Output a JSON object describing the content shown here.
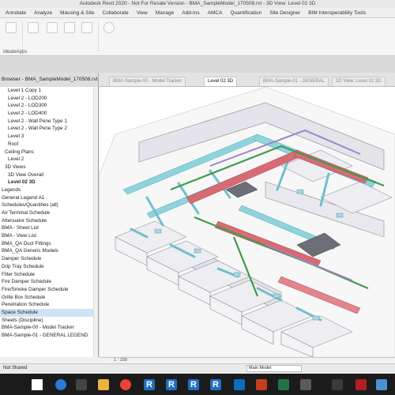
{
  "window": {
    "title": "Autodesk Revit 2020 - Not For Resale Version - BMA_SampleModel_170508.rvt - 3D View: Level 02 3D"
  },
  "menu": [
    "Annotate",
    "Analyze",
    "Massing & Site",
    "Collaborate",
    "View",
    "Manage",
    "Add-Ins",
    "AMCA",
    "Quantification",
    "Site Designer",
    "BIM Interoperability Tools"
  ],
  "ribbon": {
    "panel_label": "IdeateApps"
  },
  "browser": {
    "header": "Browser - BMA_SampleModel_170508.rvt",
    "items": [
      {
        "label": "Level 1 Copy 1",
        "indent": 2
      },
      {
        "label": "Level 2 - LOD200",
        "indent": 2
      },
      {
        "label": "Level 2 - LOD300",
        "indent": 2
      },
      {
        "label": "Level 2 - LOD400",
        "indent": 2
      },
      {
        "label": "Level 2 - Wall Pene Type 1",
        "indent": 2
      },
      {
        "label": "Level 2 - Wall Pene Type 2",
        "indent": 2
      },
      {
        "label": "Level 3",
        "indent": 2
      },
      {
        "label": "Roof",
        "indent": 2
      },
      {
        "label": "Ceiling Plans",
        "indent": 1
      },
      {
        "label": "Level 2",
        "indent": 2
      },
      {
        "label": "3D Views",
        "indent": 1
      },
      {
        "label": "3D View Overall",
        "indent": 2
      },
      {
        "label": "Level 02 3D",
        "indent": 2,
        "bold": true
      },
      {
        "label": "Legends",
        "indent": 0
      },
      {
        "label": "General Legend A1",
        "indent": 0
      },
      {
        "label": "Schedules/Quantities (all)",
        "indent": 0
      },
      {
        "label": "Air Terminal Schedule",
        "indent": 0
      },
      {
        "label": "Attenuator Schedule",
        "indent": 0
      },
      {
        "label": "BMA - Sheet List",
        "indent": 0
      },
      {
        "label": "BMA - View List",
        "indent": 0
      },
      {
        "label": "BMA_QA Duct Fittings",
        "indent": 0
      },
      {
        "label": "BMA_QA Generic Models",
        "indent": 0
      },
      {
        "label": "Damper Schedule",
        "indent": 0
      },
      {
        "label": "Drip Tray Schedule",
        "indent": 0
      },
      {
        "label": "Filter Schedule",
        "indent": 0
      },
      {
        "label": "Fire Damper Schedule",
        "indent": 0
      },
      {
        "label": "Fire/Smoke Damper Schedule",
        "indent": 0
      },
      {
        "label": "Grille Box Schedule",
        "indent": 0
      },
      {
        "label": "Penetration Schedule",
        "indent": 0
      },
      {
        "label": "Space Schedule",
        "indent": 0,
        "selected": true
      },
      {
        "label": "Sheets (Discipline)",
        "indent": 0
      },
      {
        "label": "BMA-Sample-00 - Model Tracker",
        "indent": 0
      },
      {
        "label": "BMA-Sample-01 - GENERAL LEGEND",
        "indent": 0
      }
    ]
  },
  "tabs": [
    {
      "label": "BMA-Sample-00 - Model Tracker",
      "active": false
    },
    {
      "label": "Level 02 3D",
      "active": true
    },
    {
      "label": "BMA-Sample-01 - GENERAL",
      "active": false
    },
    {
      "label": "3D View: Level 02 3D",
      "active": false
    }
  ],
  "viewbar": {
    "scale": "1 : 100"
  },
  "status": {
    "left": "Not Shared",
    "model": "Main Model"
  },
  "colors": {
    "accent": "#1e6fc4",
    "duct_supply": "#7fd0d8",
    "duct_return": "#d86b72",
    "pipe": "#56c266",
    "structure": "#e6e6ea"
  }
}
